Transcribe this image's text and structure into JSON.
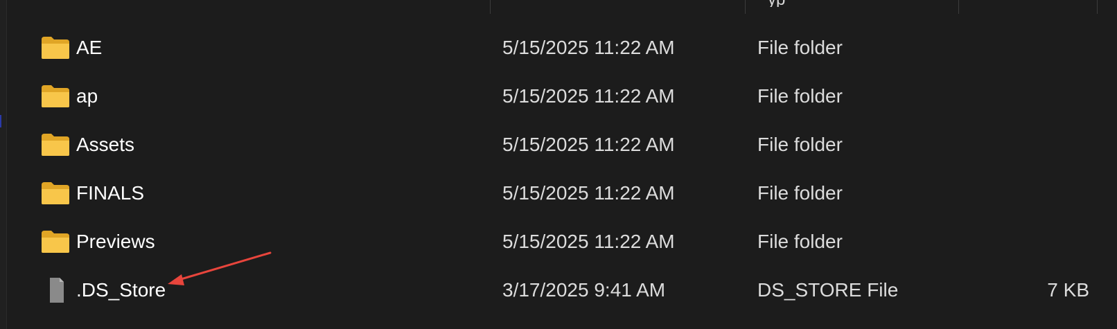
{
  "header": {
    "partial_type_header": "yp"
  },
  "files": [
    {
      "name": "AE",
      "date_modified": "5/15/2025 11:22 AM",
      "type": "File folder",
      "size": "",
      "icon": "folder-icon"
    },
    {
      "name": "ap",
      "date_modified": "5/15/2025 11:22 AM",
      "type": "File folder",
      "size": "",
      "icon": "folder-icon"
    },
    {
      "name": "Assets",
      "date_modified": "5/15/2025 11:22 AM",
      "type": "File folder",
      "size": "",
      "icon": "folder-icon"
    },
    {
      "name": "FINALS",
      "date_modified": "5/15/2025 11:22 AM",
      "type": "File folder",
      "size": "",
      "icon": "folder-icon"
    },
    {
      "name": "Previews",
      "date_modified": "5/15/2025 11:22 AM",
      "type": "File folder",
      "size": "",
      "icon": "folder-icon"
    },
    {
      "name": ".DS_Store",
      "date_modified": "3/17/2025 9:41 AM",
      "type": "DS_STORE File",
      "size": "7 KB",
      "icon": "file-icon"
    }
  ],
  "annotation": {
    "arrow_color": "#e8453c",
    "points_to": ".DS_Store"
  },
  "colors": {
    "background": "#1c1c1c",
    "folder_yellow": "#f8c64a",
    "folder_dark": "#e0a526",
    "file_gray": "#8a8a8a"
  }
}
